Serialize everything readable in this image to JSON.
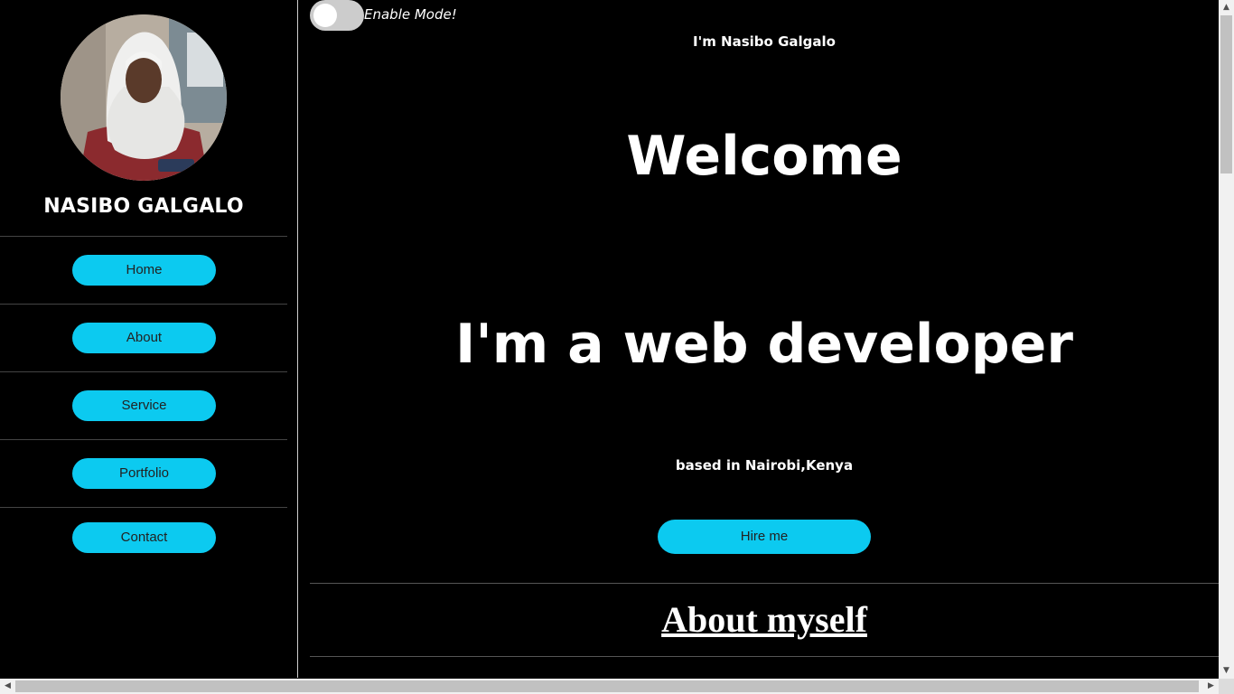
{
  "sidebar": {
    "name": "NASIBO GALGALO",
    "nav": [
      {
        "label": "Home"
      },
      {
        "label": "About"
      },
      {
        "label": "Service"
      },
      {
        "label": "Portfolio"
      },
      {
        "label": "Contact"
      }
    ]
  },
  "main": {
    "toggle_label": "Enable Mode!",
    "intro": "I'm Nasibo Galgalo",
    "welcome": "Welcome",
    "role": "I'm a web developer",
    "location": "based in Nairobi,Kenya",
    "hire_label": "Hire me",
    "about_heading": "About myself"
  },
  "colors": {
    "accent": "#0ccaf0",
    "background": "#000000",
    "text": "#ffffff"
  }
}
